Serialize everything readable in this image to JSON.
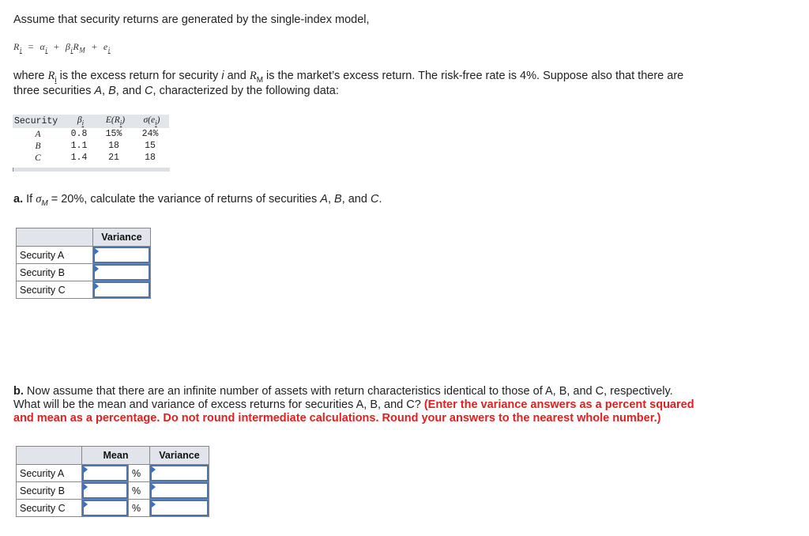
{
  "intro": "Assume that security returns are generated by the single-index model,",
  "equation": {
    "lhs": "R",
    "terms": [
      "α",
      "β",
      "R",
      "e"
    ],
    "sub_i": "i",
    "sub_M": "M"
  },
  "where": {
    "t1": "where ",
    "Ri": "R",
    "sub_i": "i",
    "t2": " is the excess return for security ",
    "i": "i",
    "t3": " and ",
    "RM": "R",
    "sub_M": "M",
    "t4": " is the market’s excess return. The risk-free rate is 4%. Suppose also that there are",
    "line2_a": "three securities ",
    "A": "A",
    "sep1": ", ",
    "B": "B",
    "sep2": ", and ",
    "C": "C",
    "line2_b": ", characterized by the following data:"
  },
  "data_table": {
    "headers": {
      "security": "Security",
      "beta": "β",
      "er": "E(R",
      "er_close": ")",
      "sigma": "σ(e",
      "sigma_close": ")",
      "sub": "i"
    },
    "rows": [
      {
        "security": "A",
        "beta": "0.8",
        "er": "15%",
        "sigma": "24%"
      },
      {
        "security": "B",
        "beta": "1.1",
        "er": "18",
        "sigma": "15"
      },
      {
        "security": "C",
        "beta": "1.4",
        "er": "21",
        "sigma": "18"
      }
    ]
  },
  "part_a": {
    "label": "a.",
    "t1": " If ",
    "sigma": "σ",
    "sub": "M",
    "t2": " = 20%, calculate the variance of returns of securities ",
    "A": "A",
    "sep1": ", ",
    "B": "B",
    "sep2": ", and ",
    "C": "C",
    "end": ".",
    "table": {
      "header": "Variance",
      "rows": [
        {
          "label": "Security A",
          "variance": ""
        },
        {
          "label": "Security B",
          "variance": ""
        },
        {
          "label": "Security C",
          "variance": ""
        }
      ]
    }
  },
  "part_b": {
    "label": "b.",
    "line1": " Now assume that there are an infinite number of assets with return characteristics identical to those of A, B, and C, respectively.",
    "line2_plain": "What will be the mean and variance of excess returns for securities A, B, and C? ",
    "line2_red": "(Enter the variance answers as a percent squared",
    "line3_red": "and mean as a percentage. Do not round intermediate calculations. Round your answers to the nearest whole number.)",
    "table": {
      "headers": [
        "Mean",
        "Variance"
      ],
      "unit": "%",
      "rows": [
        {
          "label": "Security A",
          "mean": "",
          "variance": ""
        },
        {
          "label": "Security B",
          "mean": "",
          "variance": ""
        },
        {
          "label": "Security C",
          "mean": "",
          "variance": ""
        }
      ]
    }
  },
  "colors": {
    "instruction_red": "#e02020",
    "input_border": "#4d74a8",
    "header_bg": "#e1e4ea"
  }
}
